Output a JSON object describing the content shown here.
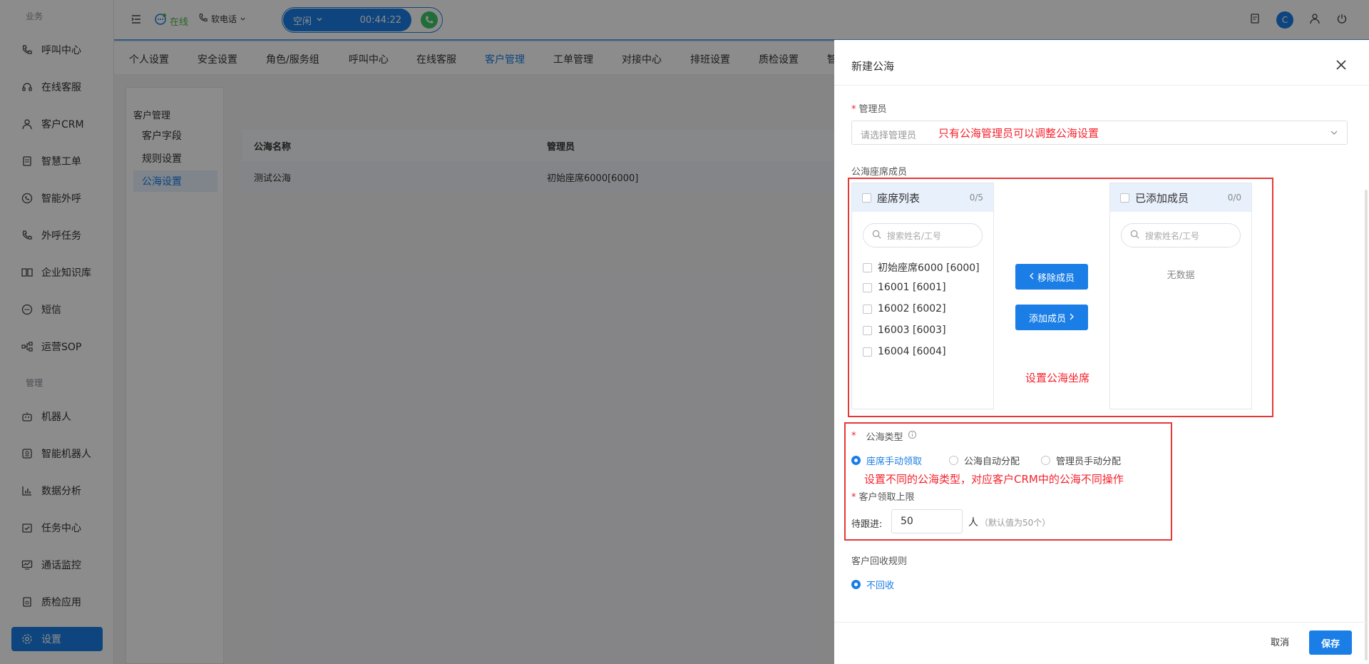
{
  "sidebar": {
    "section_business": "业务",
    "section_manage": "管理",
    "items": [
      {
        "label": "呼叫中心",
        "icon": "phone-call-icon"
      },
      {
        "label": "在线客服",
        "icon": "headset-icon"
      },
      {
        "label": "客户CRM",
        "icon": "user-icon"
      },
      {
        "label": "智慧工单",
        "icon": "document-icon"
      },
      {
        "label": "智能外呼",
        "icon": "phone-icon"
      },
      {
        "label": "外呼任务",
        "icon": "phone-task-icon"
      },
      {
        "label": "企业知识库",
        "icon": "book-icon"
      },
      {
        "label": "短信",
        "icon": "sms-icon"
      },
      {
        "label": "运营SOP",
        "icon": "flow-icon"
      },
      {
        "label": "机器人",
        "icon": "robot-icon"
      },
      {
        "label": "智能机器人",
        "icon": "smart-robot-icon"
      },
      {
        "label": "数据分析",
        "icon": "bar-chart-icon"
      },
      {
        "label": "任务中心",
        "icon": "task-icon"
      },
      {
        "label": "通话监控",
        "icon": "monitor-icon"
      },
      {
        "label": "质检应用",
        "icon": "inspection-icon"
      },
      {
        "label": "设置",
        "icon": "gear-icon"
      }
    ]
  },
  "topbar": {
    "status": "在线",
    "softphone": "软电话",
    "call_state": "空闲",
    "call_timer": "00:44:22",
    "avatar_letter": "C"
  },
  "subtabs": [
    "个人设置",
    "安全设置",
    "角色/服务组",
    "呼叫中心",
    "在线客服",
    "客户管理",
    "工单管理",
    "对接中心",
    "排班设置",
    "质检设置",
    "智"
  ],
  "subtabs_active": 5,
  "inner_menu": {
    "head": "客户管理",
    "items": [
      "客户字段",
      "规则设置",
      "公海设置"
    ],
    "active": 2
  },
  "table": {
    "headers": [
      "公海名称",
      "管理员"
    ],
    "rows": [
      [
        "测试公海",
        "初始座席6000[6000]"
      ]
    ]
  },
  "drawer": {
    "title": "新建公海",
    "admin_label": "管理员",
    "admin_placeholder": "请选择管理员",
    "admin_annotation": "只有公海管理员可以调整公海设置",
    "members_label": "公海座席成员",
    "left_panel": {
      "title": "座席列表",
      "count": "0/5",
      "search_placeholder": "搜索姓名/工号",
      "items": [
        "初始座席6000 [6000]",
        "16001 [6001]",
        "16002 [6002]",
        "16003 [6003]",
        "16004 [6004]"
      ]
    },
    "right_panel": {
      "title": "已添加成员",
      "count": "0/0",
      "search_placeholder": "搜索姓名/工号",
      "empty": "无数据"
    },
    "remove_btn": "移除成员",
    "add_btn": "添加成员",
    "members_annotation": "设置公海坐席",
    "type_label": "公海类型",
    "type_options": [
      "座席手动领取",
      "公海自动分配",
      "管理员手动分配"
    ],
    "type_selected": 0,
    "type_annotation": "设置不同的公海类型，对应客户CRM中的公海不同操作",
    "limit_label": "客户领取上限",
    "limit_prefix": "待跟进:",
    "limit_value": "50",
    "limit_unit": "人",
    "limit_hint": "（默认值为50个）",
    "recycle_label": "客户回收规则",
    "recycle_option": "不回收",
    "cancel": "取消",
    "save": "保存"
  },
  "colors": {
    "primary": "#1a7ee6",
    "annotation_red": "#e53935",
    "online_green": "#52b848",
    "call_green": "#3cc76a"
  }
}
